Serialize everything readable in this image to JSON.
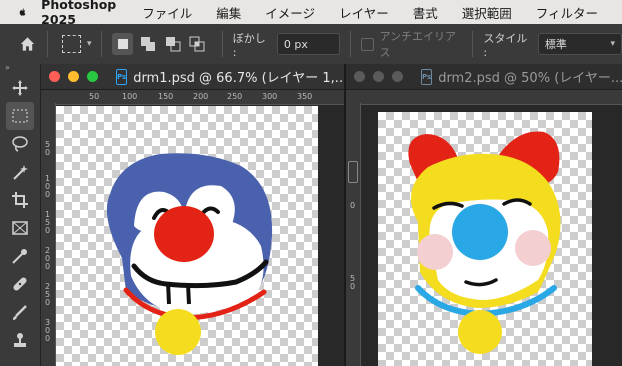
{
  "menubar": {
    "app_name": "Photoshop 2025",
    "items": [
      "ファイル",
      "編集",
      "イメージ",
      "レイヤー",
      "書式",
      "選択範囲",
      "フィルター"
    ]
  },
  "options_bar": {
    "feather_label": "ぼかし :",
    "feather_value": "0 px",
    "antialias_label": "アンチエイリアス",
    "style_label": "スタイル :",
    "style_value": "標準"
  },
  "doc1": {
    "title": "drm1.psd @ 66.7% (レイヤー 1,...",
    "ruler_h": [
      "50",
      "100",
      "150",
      "200",
      "250",
      "300",
      "350"
    ],
    "ruler_v": [
      "5 0",
      "1 0 0",
      "1 5 0",
      "2 0 0",
      "2 5 0",
      "3 0 0"
    ]
  },
  "doc2": {
    "title": "drm2.psd @ 50% (レイヤー...",
    "ruler_v": [
      "0",
      "5 0"
    ]
  },
  "colors": {
    "menubar_bg": "#e8e6e4",
    "panel_bg": "#3a3a3a",
    "light_red": "#ff5f57",
    "light_yellow": "#febc2e",
    "light_green": "#28c840",
    "inactive_light": "#5a5a5a",
    "ps_blue": "#2fa3f7"
  }
}
